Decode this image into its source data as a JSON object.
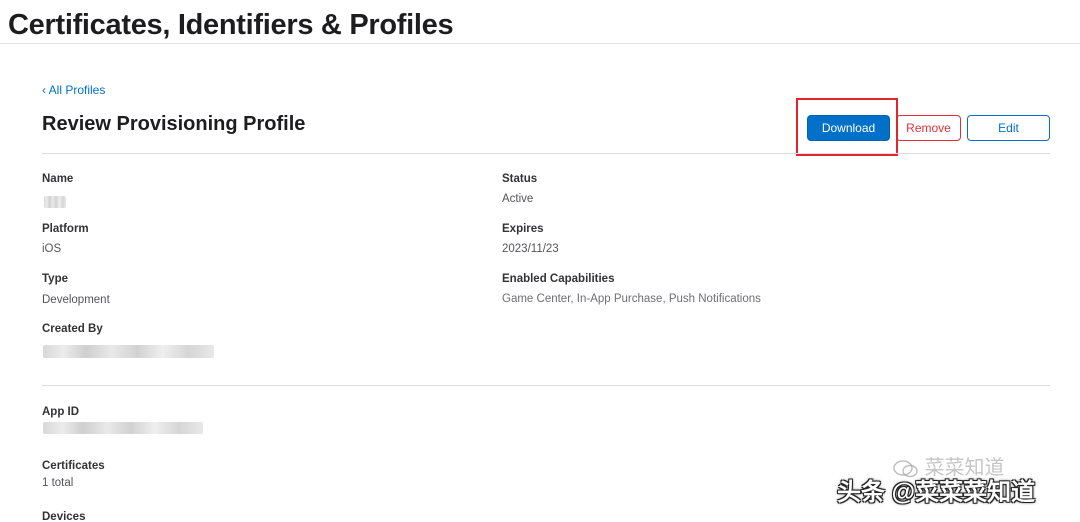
{
  "page": {
    "title": "Certificates, Identifiers & Profiles"
  },
  "breadcrumb": {
    "back_label": "‹ All Profiles"
  },
  "profile": {
    "heading": "Review Provisioning Profile"
  },
  "actions": {
    "download_label": "Download",
    "remove_label": "Remove",
    "edit_label": "Edit"
  },
  "fields": {
    "name": {
      "label": "Name",
      "value": ""
    },
    "platform": {
      "label": "Platform",
      "value": "iOS"
    },
    "type": {
      "label": "Type",
      "value": "Development"
    },
    "created_by": {
      "label": "Created By",
      "value": ""
    },
    "status": {
      "label": "Status",
      "value": "Active"
    },
    "expires": {
      "label": "Expires",
      "value": "2023/11/23"
    },
    "capabilities": {
      "label": "Enabled Capabilities",
      "value": "Game Center, In-App Purchase, Push Notifications"
    },
    "app_id": {
      "label": "App ID",
      "value": ""
    },
    "certificates": {
      "label": "Certificates",
      "value": "1 total"
    },
    "devices": {
      "label": "Devices"
    }
  },
  "watermark": {
    "primary": "头条 @菜菜菜知道",
    "secondary": "菜菜知道"
  },
  "colors": {
    "accent": "#0070c9",
    "danger": "#e0303b",
    "highlight": "#e3262b"
  }
}
